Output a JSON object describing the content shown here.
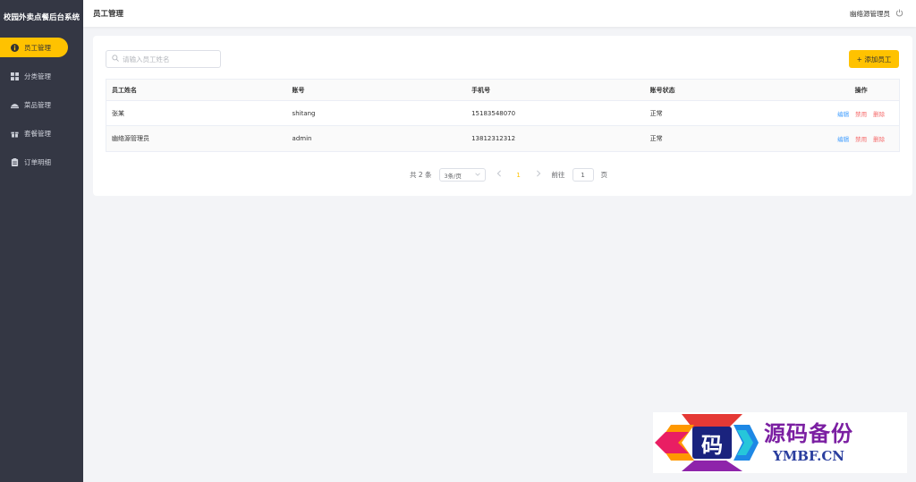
{
  "app": {
    "title": "校园外卖点餐后台系统"
  },
  "sidebar": {
    "items": [
      {
        "label": "员工管理",
        "icon": "info-circle-icon",
        "active": true
      },
      {
        "label": "分类管理",
        "icon": "grid-icon",
        "active": false
      },
      {
        "label": "菜品管理",
        "icon": "dish-icon",
        "active": false
      },
      {
        "label": "套餐管理",
        "icon": "gift-box-icon",
        "active": false
      },
      {
        "label": "订单明细",
        "icon": "clipboard-icon",
        "active": false
      }
    ]
  },
  "header": {
    "title": "员工管理",
    "user": "幽络源管理员",
    "logout_icon": "power-icon"
  },
  "toolbar": {
    "search_placeholder": "请输入员工姓名",
    "search_value": "",
    "add_label": "+ 添加员工"
  },
  "table": {
    "columns": [
      "员工姓名",
      "账号",
      "手机号",
      "账号状态",
      "操作"
    ],
    "rows": [
      {
        "name": "张某",
        "account": "shitang",
        "phone": "15183548070",
        "status": "正常"
      },
      {
        "name": "幽络源管理员",
        "account": "admin",
        "phone": "13812312312",
        "status": "正常"
      }
    ],
    "actions": {
      "edit": "编辑",
      "disable": "禁用",
      "delete": "删除"
    }
  },
  "pagination": {
    "total_text": "共 2 条",
    "page_size": "3条/页",
    "current_page": "1",
    "jump_prefix": "前往",
    "jump_value": "1",
    "jump_suffix": "页"
  },
  "watermark": {
    "cn": "源码备份",
    "en": "YMBF.CN",
    "logo_char": "码"
  },
  "colors": {
    "accent": "#ffc200",
    "sidebar_bg": "#343744",
    "link_blue": "#419eff",
    "danger_red": "#f56c6c"
  }
}
